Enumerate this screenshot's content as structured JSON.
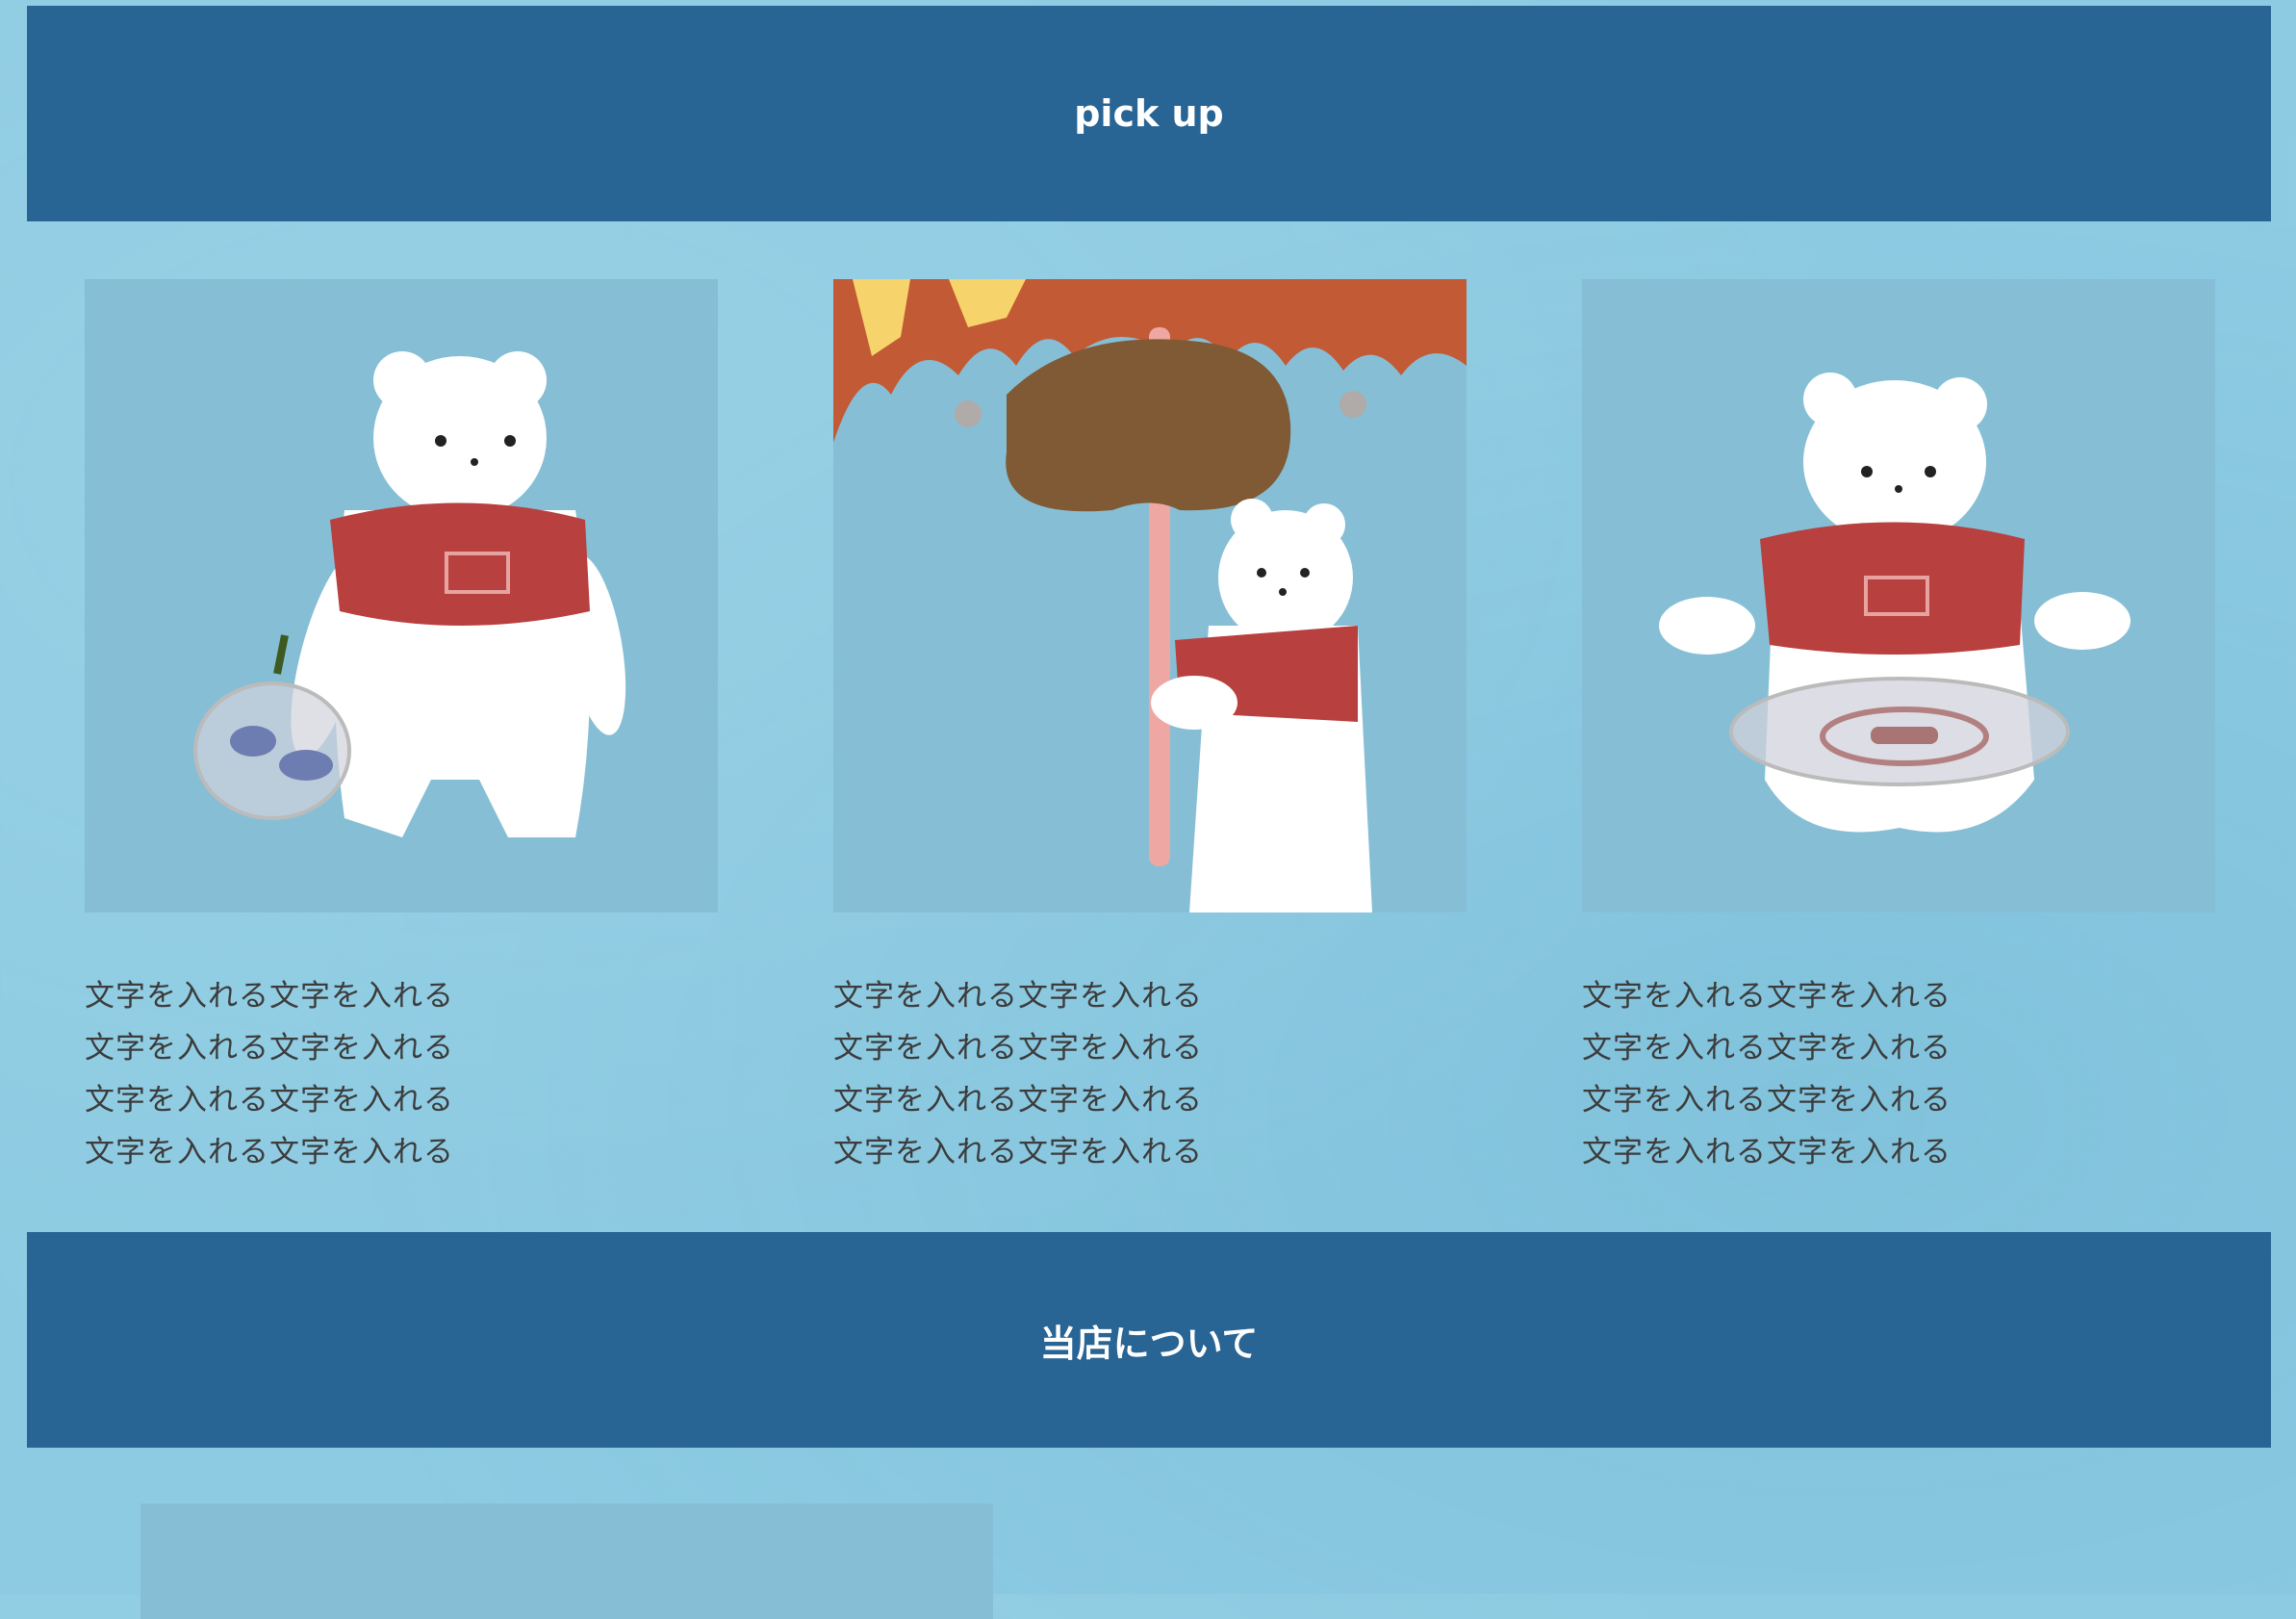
{
  "sections": {
    "pickup": {
      "title": "pick up"
    },
    "about": {
      "title": "当店について"
    }
  },
  "cards": [
    {
      "image": "bear-with-shopping-bag-illustration",
      "lines": [
        "文字を入れる文字を入れる",
        "文字を入れる文字を入れる",
        "文字を入れる文字を入れる",
        "文字を入れる文字を入れる"
      ]
    },
    {
      "image": "bear-holding-giant-meat-illustration",
      "lines": [
        "文字を入れる文字を入れる",
        "文字を入れる文字を入れる",
        "文字を入れる文字を入れる",
        "文字を入れる文字を入れる"
      ]
    },
    {
      "image": "bear-sitting-with-bag-illustration",
      "lines": [
        "文字を入れる文字を入れる",
        "文字を入れる文字を入れる",
        "文字を入れる文字を入れる",
        "文字を入れる文字を入れる"
      ]
    }
  ],
  "colors": {
    "background": "#8ccbe2",
    "banner": "#286494",
    "banner_text": "#ffffff",
    "body_text": "#3c3c3c",
    "image_placeholder": "#86bfd5",
    "bear_shirt": "#b8403e"
  }
}
